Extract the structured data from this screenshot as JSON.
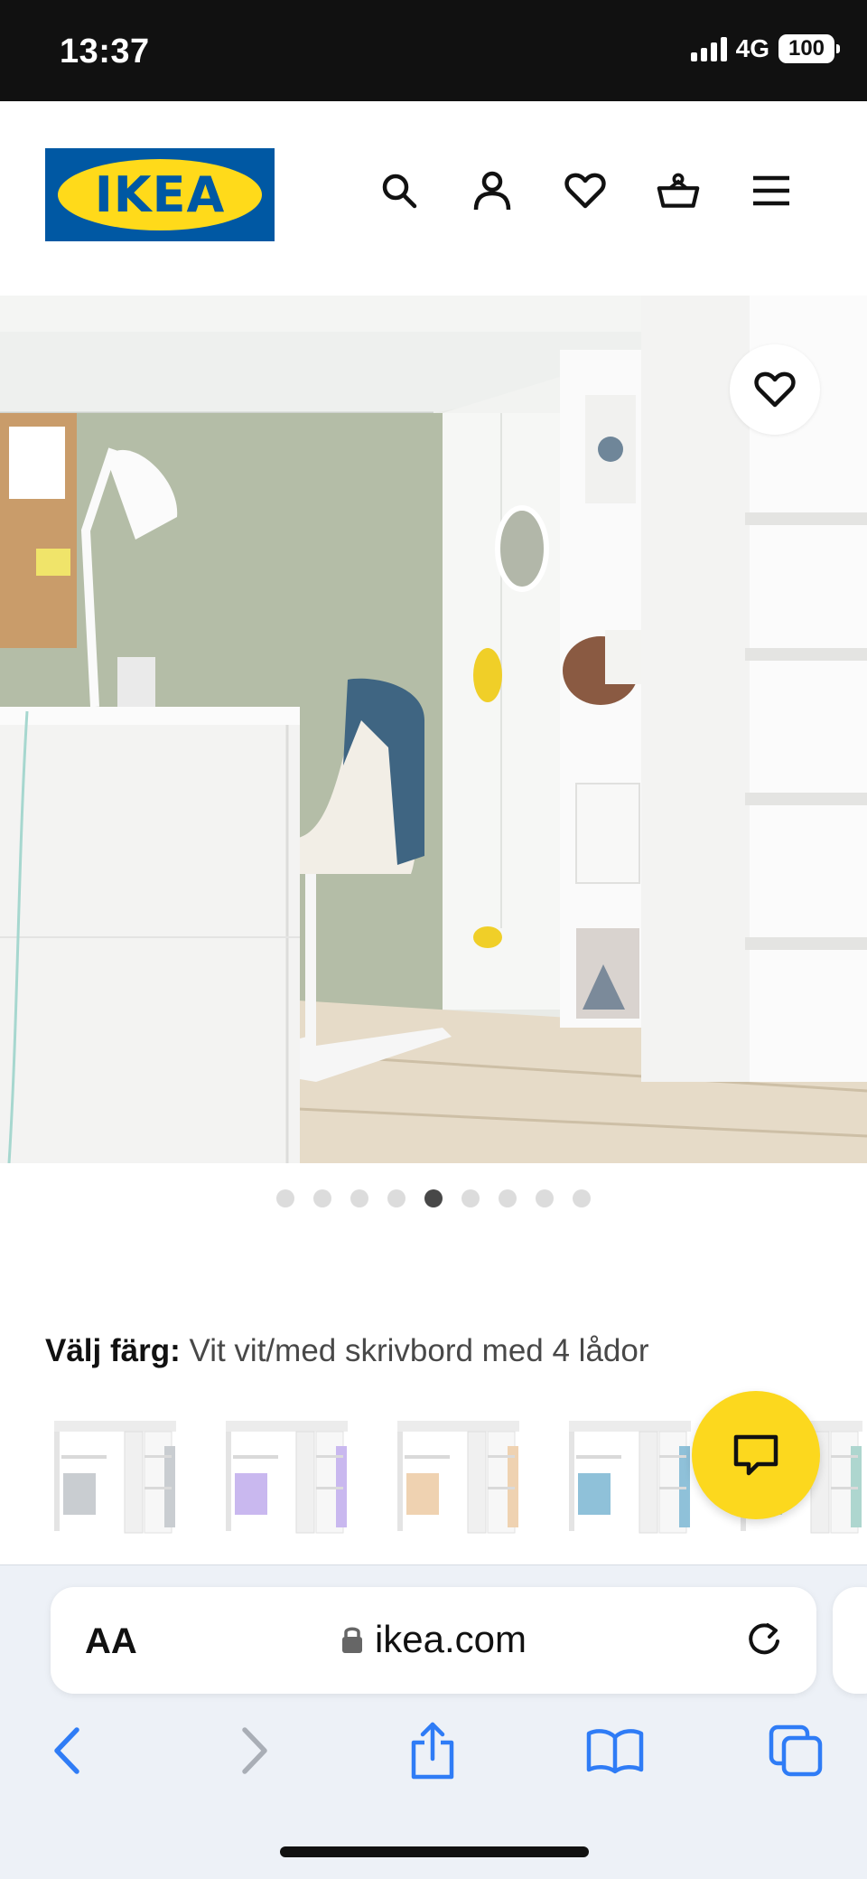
{
  "status_bar": {
    "time": "13:37",
    "network": "4G",
    "battery": "100"
  },
  "header": {
    "logo_text": "IKEA",
    "icons": [
      "search-icon",
      "user-icon",
      "heart-icon",
      "basket-icon",
      "menu-icon"
    ]
  },
  "gallery": {
    "image_count": 9,
    "active_index": 4
  },
  "color_picker": {
    "label": "Välj färg:",
    "value": "Vit vit/med skrivbord med 4 lådor",
    "swatch_accents": [
      "#c9cdd1",
      "#c9b8ef",
      "#efd2b1",
      "#8fc1d9",
      "#aed6cf"
    ]
  },
  "browser": {
    "aa_label": "AA",
    "url": "ikea.com"
  },
  "colors": {
    "ikea_blue": "#0058a3",
    "ikea_yellow": "#ffda1a",
    "chat_yellow": "#fcd81e",
    "safari_blue": "#2f7cf6"
  }
}
